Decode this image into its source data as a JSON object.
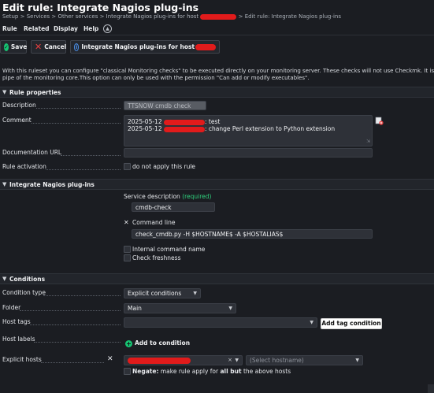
{
  "page": {
    "title": "Edit rule: Integrate Nagios plug-ins",
    "breadcrumb": {
      "part1": "Setup > Services > Other services > Integrate Nagios plug-ins for host",
      "part2": "> Edit rule: Integrate Nagios plug-ins"
    }
  },
  "menu": {
    "items": [
      "Rule",
      "Related",
      "Display",
      "Help"
    ],
    "toggle_icon": "chevron-up-icon"
  },
  "actions": {
    "save": "Save",
    "cancel": "Cancel",
    "info": "Integrate Nagios plug-ins for host",
    "save_color": "#16c473",
    "cancel_color": "#e93f3f",
    "info_color": "#4a8ee6"
  },
  "description": {
    "line1": "With this ruleset you can configure \"classical Monitoring checks\" to be executed directly on your monitoring server. These checks will not use Checkmk. It is also",
    "line2": "pipe of the monitoring core.This option can only be used with the permission \"Can add or modify executables\"."
  },
  "rule_properties": {
    "header": "Rule properties",
    "description_label": "Description",
    "description_value": "TTSNOW cmdb check",
    "comment_label": "Comment",
    "comment_line1_prefix": "2025-05-12",
    "comment_line1_suffix": ": test",
    "comment_line2_prefix": "2025-05-12",
    "comment_line2_suffix": ": change Perl extension to Python extension",
    "doc_url_label": "Documentation URL",
    "doc_url_value": "",
    "activation_label": "Rule activation",
    "activation_checkbox": "do not apply this rule"
  },
  "plugin": {
    "header": "Integrate Nagios plug-ins",
    "service_description_label": "Service description",
    "required": "(required)",
    "service_description_value": "cmdb-check",
    "command_line_label": "Command line",
    "command_line_value": "check_cmdb.py -H $HOSTNAME$ -A $HOSTALIAS$",
    "internal_command_name": "Internal command name",
    "check_freshness": "Check freshness"
  },
  "conditions": {
    "header": "Conditions",
    "condition_type_label": "Condition type",
    "condition_type_value": "Explicit conditions",
    "folder_label": "Folder",
    "folder_value": "Main",
    "host_tags_label": "Host tags",
    "host_tags_value": "",
    "add_tag_condition": "Add tag condition",
    "host_labels_label": "Host labels",
    "add_to_condition": "Add to condition",
    "explicit_hosts_label": "Explicit hosts",
    "select_hostname_placeholder": "(Select hostname)",
    "negate_prefix": "Negate:",
    "negate_mid": "make rule apply for",
    "negate_bold": "all but",
    "negate_suffix": "the above hosts"
  },
  "accent": {
    "redaction": "#e11b1b",
    "required": "#2fd17d"
  }
}
